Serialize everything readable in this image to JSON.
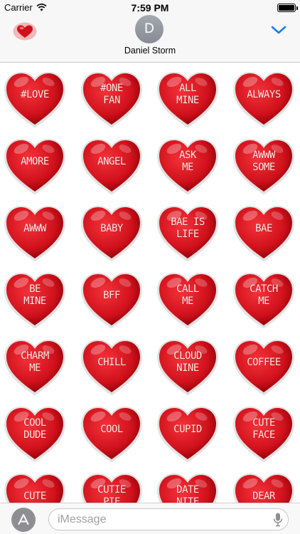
{
  "status_bar": {
    "carrier": "Carrier",
    "time": "7:59 PM"
  },
  "header": {
    "app_icon": "heart-sticker-icon",
    "avatar_initial": "D",
    "contact_name": "Daniel Storm",
    "collapse_icon": "chevron-down-icon",
    "accent_color": "#1a7cf7"
  },
  "stickers": [
    "#LOVE",
    "#ONE\nFAN",
    "ALL\nMINE",
    "ALWAYS",
    "AMORE",
    "ANGEL",
    "ASK\nME",
    "AWWW\nSOME",
    "AWWW",
    "BABY",
    "BAE IS\nLIFE",
    "BAE",
    "BE\nMINE",
    "BFF",
    "CALL\nME",
    "CATCH\nME",
    "CHARM\nME",
    "CHILL",
    "CLOUD\nNINE",
    "COFFEE",
    "COOL\nDUDE",
    "COOL",
    "CUPID",
    "CUTE\nFACE",
    "CUTE",
    "CUTIE\nPIE",
    "DATE\nNITE",
    "DEAR"
  ],
  "sticker_color": "#d0111b",
  "bottom_bar": {
    "app_store_icon": "app-store-icon",
    "message_placeholder": "iMessage",
    "mic_icon": "microphone-icon"
  }
}
